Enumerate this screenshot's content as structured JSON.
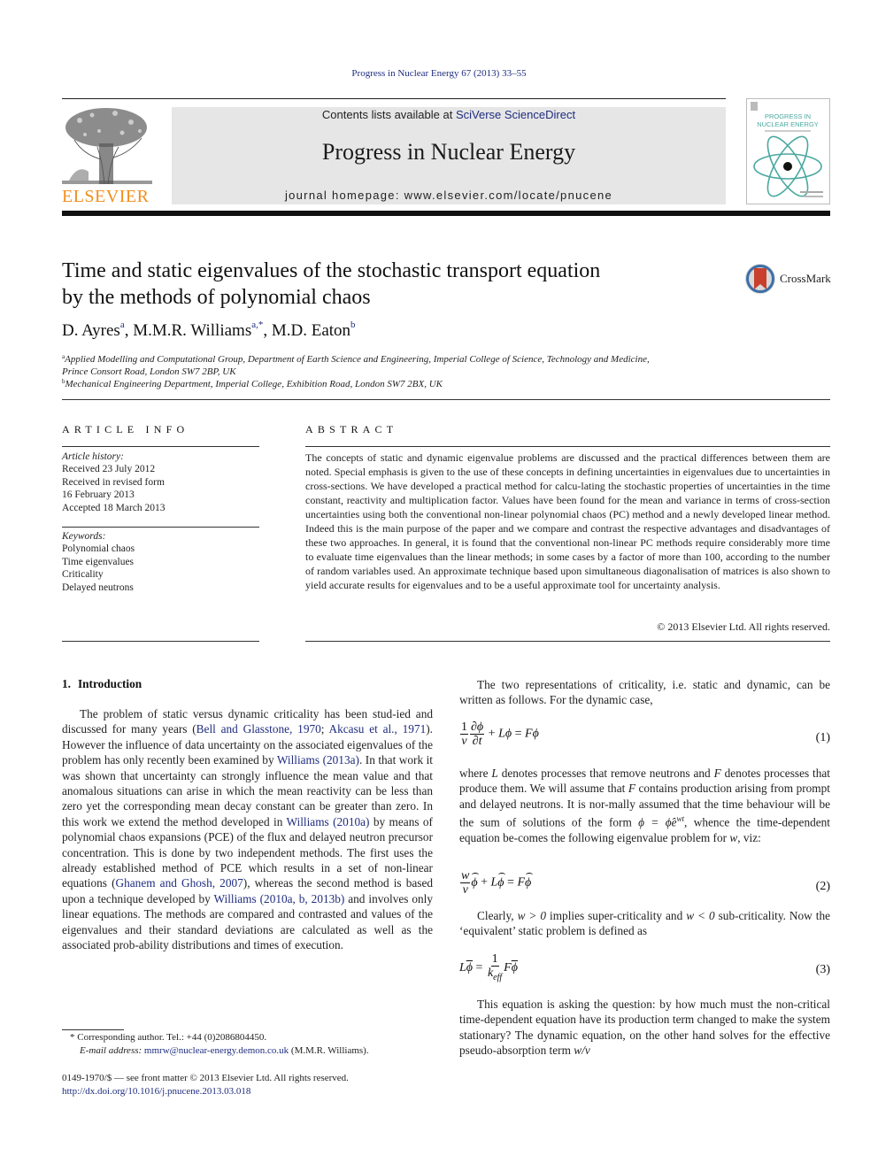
{
  "running_head": "Progress in Nuclear Energy 67 (2013) 33–55",
  "masthead": {
    "contents_prefix": "Contents lists available at ",
    "contents_link": "SciVerse ScienceDirect",
    "journal_title": "Progress in Nuclear Energy",
    "homepage_prefix": "journal homepage: ",
    "homepage_url": "www.elsevier.com/locate/pnucene",
    "publisher_logo_text": "ELSEVIER",
    "cover_title_line1": "PROGRESS IN",
    "cover_title_line2": "NUCLEAR ENERGY",
    "brand_orange": "#f28e1c",
    "link_blue": "#1f2d7f",
    "cover_teal": "#4aa8a0"
  },
  "article": {
    "title_line1": "Time and static eigenvalues of the stochastic transport equation",
    "title_line2": "by the methods of polynomial chaos",
    "crossmark_label": "CrossMark",
    "authors": [
      {
        "name": "D. Ayres",
        "sup": "a"
      },
      {
        "name": "M.M.R. Williams",
        "sup": "a,*"
      },
      {
        "name": "M.D. Eaton",
        "sup": "b"
      }
    ],
    "affiliations": [
      {
        "sup": "a",
        "line1": "Applied Modelling and Computational Group, Department of Earth Science and Engineering, Imperial College of Science, Technology and Medicine,",
        "line2": "Prince Consort Road, London SW7 2BP, UK"
      },
      {
        "sup": "b",
        "line1": "Mechanical Engineering Department, Imperial College, Exhibition Road, London SW7 2BX, UK"
      }
    ]
  },
  "article_info": {
    "heading": "ARTICLE INFO",
    "history_label": "Article history:",
    "history": [
      "Received 23 July 2012",
      "Received in revised form",
      "16 February 2013",
      "Accepted 18 March 2013"
    ],
    "keywords_label": "Keywords:",
    "keywords": [
      "Polynomial chaos",
      "Time eigenvalues",
      "Criticality",
      "Delayed neutrons"
    ]
  },
  "abstract": {
    "heading": "ABSTRACT",
    "text": "The concepts of static and dynamic eigenvalue problems are discussed and the practical differences between them are noted. Special emphasis is given to the use of these concepts in defining uncertainties in eigenvalues due to uncertainties in cross-sections. We have developed a practical method for calcu-lating the stochastic properties of uncertainties in the time constant, reactivity and multiplication factor. Values have been found for the mean and variance in terms of cross-section uncertainties using both the conventional non-linear polynomial chaos (PC) method and a newly developed linear method. Indeed this is the main purpose of the paper and we compare and contrast the respective advantages and disadvantages of these two approaches. In general, it is found that the conventional non-linear PC methods require considerably more time to evaluate time eigenvalues than the linear methods; in some cases by a factor of more than 100, according to the number of random variables used. An approximate technique based upon simultaneous diagonalisation of matrices is also shown to yield accurate results for eigenvalues and to be a useful approximate tool for uncertainty analysis.",
    "copyright": "© 2013 Elsevier Ltd. All rights reserved."
  },
  "intro": {
    "number": "1.",
    "title": "Introduction",
    "p1_a": "The problem of static versus dynamic criticality has been stud-ied and discussed for many years (",
    "ref1": "Bell and Glasstone, 1970",
    "sep1": "; ",
    "ref2": "Akcasu et al., 1971",
    "p1_b": "). However the influence of data uncertainty on the associated eigenvalues of the problem has only recently been examined by ",
    "ref3": "Williams (2013a)",
    "p1_c": ". In that work it was shown that uncertainty can strongly influence the mean value and that anomalous situations can arise in which the mean reactivity can be less than zero yet the corresponding mean decay constant can be greater than zero. In this work we extend the method developed in ",
    "ref4": "Williams (2010a)",
    "p1_d": " by means of polynomial chaos expansions (PCE) of the flux and delayed neutron precursor concentration. This is done by two independent methods. The first uses the already established method of PCE which results in a set of non-linear equations (",
    "ref5": "Ghanem and Ghosh, 2007",
    "p1_e": "), whereas the second method is based upon a technique developed by ",
    "ref6": "Williams (2010a, b, 2013b)",
    "p1_f": " and involves only linear equations. The methods are compared and contrasted and values of the eigenvalues and their standard deviations are calculated as well as the associated prob-ability distributions and times of execution.",
    "right_p1": "The two representations of criticality, i.e. static and dynamic, can be written as follows. For the dynamic case,",
    "right_p2_a": "where ",
    "right_p2_L": "L",
    "right_p2_b": " denotes processes that remove neutrons and ",
    "right_p2_F": "F",
    "right_p2_c": " denotes processes that produce them. We will assume that ",
    "right_p2_F2": "F",
    "right_p2_d": " contains production arising from prompt and delayed neutrons. It is nor-mally assumed that the time behaviour will be the sum of solutions of the form ",
    "right_p2_form": "ϕ = ϕ̂e",
    "right_p2_exp": "wt",
    "right_p2_e": ", whence the time-dependent equation be-comes the following eigenvalue problem for ",
    "right_p2_w": "w",
    "right_p2_f": ", viz:",
    "right_p3_a": "Clearly, ",
    "right_p3_cond1": "w > 0",
    "right_p3_b": " implies super-criticality and ",
    "right_p3_cond2": "w < 0",
    "right_p3_c": " sub-criticality. Now the ‘equivalent’ static problem is defined as",
    "right_p4_a": "This equation is asking the question: by how much must the non-critical time-dependent equation have its production term changed to make the system stationary? The dynamic equation, on the other hand solves for the effective pseudo-absorption term ",
    "right_p4_term": "w/v"
  },
  "equations": [
    {
      "number": "(1)"
    },
    {
      "number": "(2)"
    },
    {
      "number": "(3)"
    }
  ],
  "footnote": {
    "star_text": "* Corresponding author. Tel.: +44 (0)2086804450.",
    "email_label": "E-mail address: ",
    "email": "mmrw@nuclear-energy.demon.co.uk",
    "email_suffix": " (M.M.R. Williams)."
  },
  "front_matter": {
    "issn_line": "0149-1970/$ — see front matter © 2013 Elsevier Ltd. All rights reserved.",
    "doi": "http://dx.doi.org/10.1016/j.pnucene.2013.03.018"
  }
}
